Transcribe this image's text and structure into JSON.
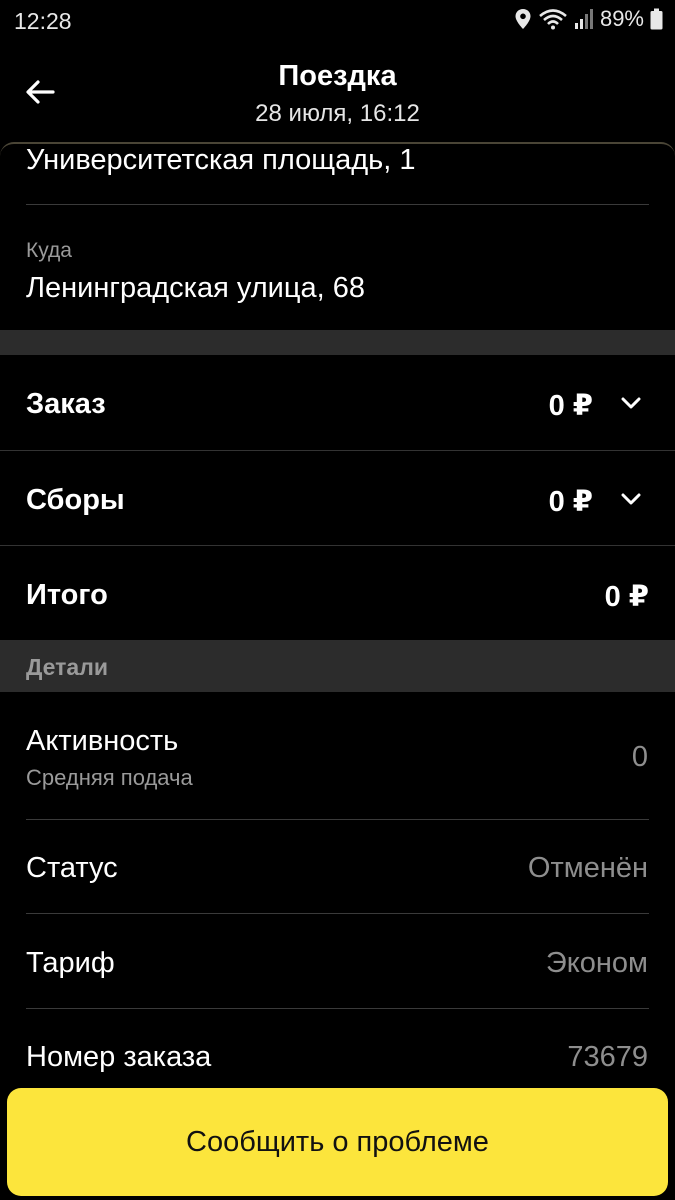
{
  "status_bar": {
    "time": "12:28",
    "battery": "89%"
  },
  "header": {
    "title": "Поездка",
    "subtitle": "28 июля, 16:12"
  },
  "route": {
    "from": "Университетская площадь, 1",
    "to_label": "Куда",
    "to": "Ленинградская улица, 68"
  },
  "prices": {
    "order_label": "Заказ",
    "order_value": "0 ₽",
    "fees_label": "Сборы",
    "fees_value": "0 ₽",
    "total_label": "Итого",
    "total_value": "0 ₽"
  },
  "details": {
    "title": "Детали",
    "activity_label": "Активность",
    "activity_sub": "Средняя подача",
    "activity_value": "0",
    "status_label": "Статус",
    "status_value": "Отменён",
    "tariff_label": "Тариф",
    "tariff_value": "Эконом",
    "order_number_label": "Номер заказа",
    "order_number_value": "73679"
  },
  "actions": {
    "report_label": "Сообщить о проблеме"
  },
  "colors": {
    "accent": "#fce53c",
    "background": "#000000",
    "band": "#2c2c2c"
  }
}
